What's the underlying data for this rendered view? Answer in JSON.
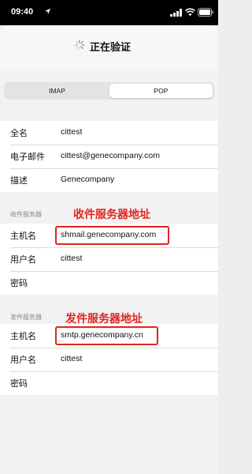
{
  "status_bar": {
    "time": "09:40"
  },
  "nav": {
    "title": "正在验证"
  },
  "segmented": {
    "imap": "IMAP",
    "pop": "POP",
    "selected": "POP"
  },
  "account": [
    {
      "label": "全名",
      "value": "cittest"
    },
    {
      "label": "电子邮件",
      "value": "cittest@genecompany.com"
    },
    {
      "label": "描述",
      "value": "Genecompany"
    }
  ],
  "incoming": {
    "header": "收件服务器",
    "annotation": "收件服务器地址",
    "rows": [
      {
        "label": "主机名",
        "value": "shmail.genecompany.com"
      },
      {
        "label": "用户名",
        "value": "cittest"
      },
      {
        "label": "密码",
        "value": ""
      }
    ]
  },
  "outgoing": {
    "header": "发件服务器",
    "annotation": "发件服务器地址",
    "rows": [
      {
        "label": "主机名",
        "value": "smtp.genecompany.cn"
      },
      {
        "label": "用户名",
        "value": "cittest"
      },
      {
        "label": "密码",
        "value": ""
      }
    ]
  },
  "colors": {
    "annotation": "#e0251f",
    "background": "#f2f2f4"
  }
}
